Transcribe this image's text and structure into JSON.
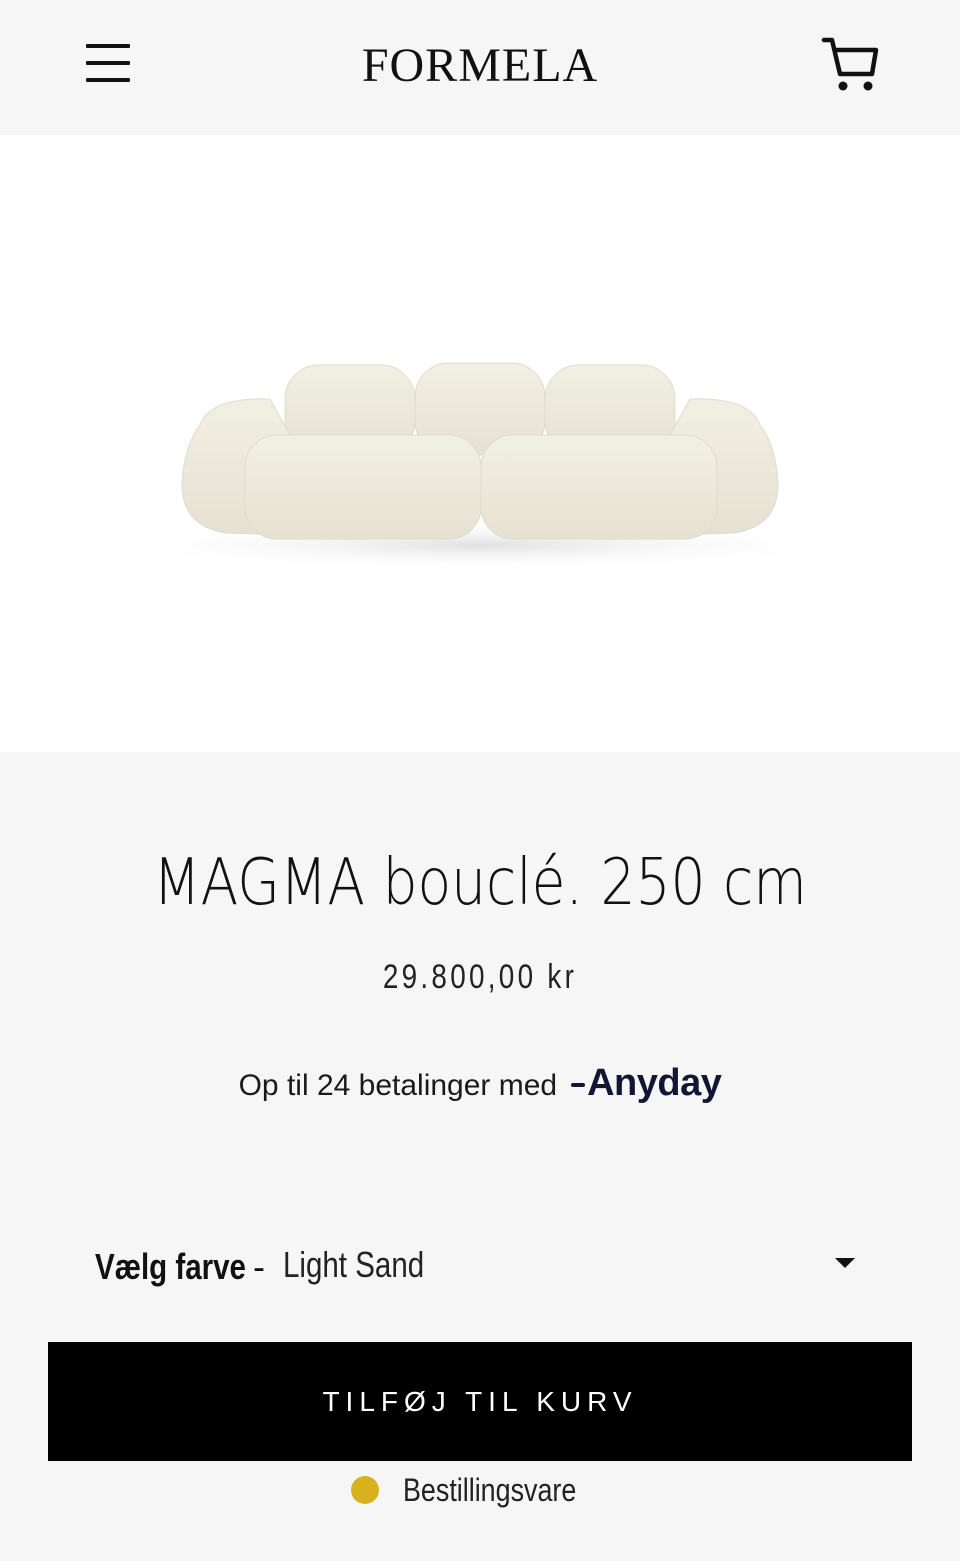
{
  "header": {
    "menu_icon": "hamburger-menu-icon",
    "logo_text": "FORMELA",
    "cart_icon": "shopping-cart-icon"
  },
  "product": {
    "image_alt": "MAGMA bouclé sofa",
    "title": "MAGMA bouclé. 250 cm",
    "price": "29.800,00 kr"
  },
  "financing": {
    "text": "Op til 24 betalinger med",
    "provider": "Anyday"
  },
  "variant": {
    "label": "Vælg farve",
    "separator": "-",
    "selected": "Light Sand",
    "caret_icon": "chevron-down-icon"
  },
  "actions": {
    "add_to_cart": "TILFØJ TIL KURV"
  },
  "availability": {
    "status": "Bestillingsvare",
    "dot_color": "#d8b21e"
  }
}
